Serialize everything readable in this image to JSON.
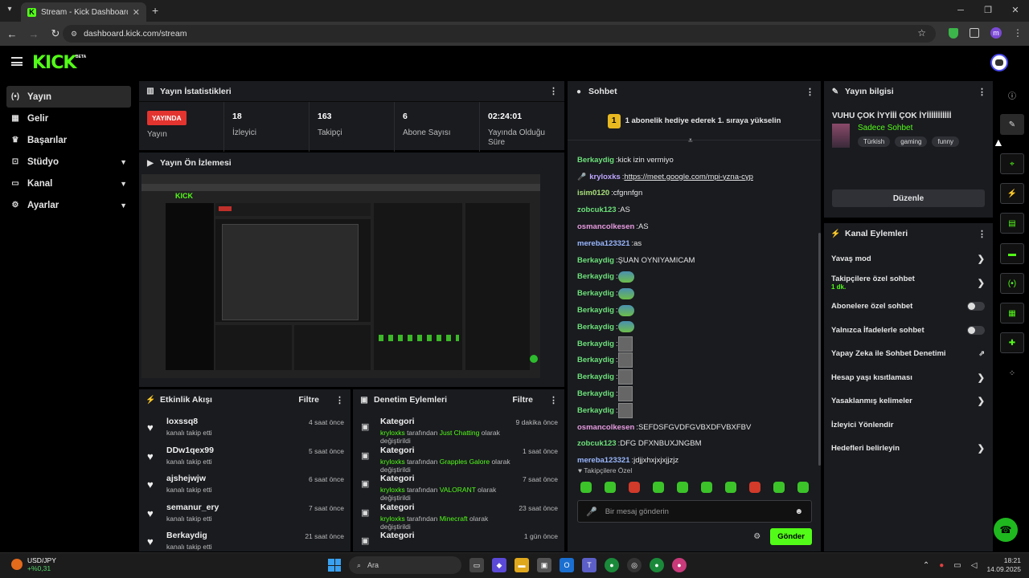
{
  "browser": {
    "tab_title": "Stream - Kick Dashboard",
    "url": "dashboard.kick.com/stream",
    "profile_initial": "m",
    "new_tab_symbol": "+"
  },
  "header": {
    "logo": "KICK",
    "beta": "BETA"
  },
  "sidebar": {
    "items": [
      {
        "label": "Yayın",
        "icon": "broadcast-icon",
        "active": true
      },
      {
        "label": "Gelir",
        "icon": "revenue-icon"
      },
      {
        "label": "Başarılar",
        "icon": "trophy-icon"
      },
      {
        "label": "Stüdyo",
        "icon": "studio-icon",
        "expandable": true
      },
      {
        "label": "Kanal",
        "icon": "channel-icon",
        "expandable": true
      },
      {
        "label": "Ayarlar",
        "icon": "gear-icon",
        "expandable": true
      }
    ]
  },
  "stats": {
    "title": "Yayın İstatistikleri",
    "live_badge": "YAYINDA",
    "live_label": "Yayın",
    "items": [
      {
        "value": "18",
        "label": "İzleyici"
      },
      {
        "value": "163",
        "label": "Takipçi"
      },
      {
        "value": "6",
        "label": "Abone Sayısı"
      },
      {
        "value": "02:24:01",
        "label": "Yayında Olduğu Süre"
      }
    ]
  },
  "preview": {
    "title": "Yayın Ön İzlemesi"
  },
  "activity": {
    "title": "Etkinlik Akışı",
    "filter": "Filtre",
    "rows": [
      {
        "name": "loxssq8",
        "sub": "kanalı takip etti",
        "time": "4 saat önce"
      },
      {
        "name": "DDw1qex99",
        "sub": "kanalı takip etti",
        "time": "5 saat önce"
      },
      {
        "name": "ajshejwjw",
        "sub": "kanalı takip etti",
        "time": "6 saat önce"
      },
      {
        "name": "semanur_ery",
        "sub": "kanalı takip etti",
        "time": "7 saat önce"
      },
      {
        "name": "Berkaydig",
        "sub": "kanalı takip etti",
        "time": "21 saat önce"
      }
    ]
  },
  "moderation": {
    "title": "Denetim Eylemleri",
    "filter": "Filtre",
    "rows": [
      {
        "name": "Kategori",
        "user": "kryloxks",
        "mid": " tarafından ",
        "cat": "Just Chatting",
        "end": " olarak değiştirildi",
        "time": "9 dakika önce"
      },
      {
        "name": "Kategori",
        "user": "kryloxks",
        "mid": " tarafından ",
        "cat": "Grapples Galore",
        "end": " olarak değiştirildi",
        "time": "1 saat önce"
      },
      {
        "name": "Kategori",
        "user": "kryloxks",
        "mid": " tarafından ",
        "cat": "VALORANT",
        "end": " olarak değiştirildi",
        "time": "7 saat önce"
      },
      {
        "name": "Kategori",
        "user": "kryloxks",
        "mid": " tarafından ",
        "cat": "Minecraft",
        "end": " olarak değiştirildi",
        "time": "23 saat önce"
      },
      {
        "name": "Kategori",
        "user": "",
        "mid": "",
        "cat": "",
        "end": "",
        "time": "1 gün önce"
      }
    ]
  },
  "chat": {
    "title": "Sohbet",
    "banner": "1 abonelik hediye ederek 1. sıraya yükselin",
    "messages": [
      {
        "user": "Berkaydig",
        "color": "c-green",
        "text": "kick izin vermiyo"
      },
      {
        "user": "kryloxks",
        "color": "c-lav",
        "text": "https://meet.google.com/mpi-yzna-cyp",
        "link": true,
        "badge": true
      },
      {
        "user": "isim0120",
        "color": "c-lgreen",
        "text": "cfgnnfgn"
      },
      {
        "user": "zobcuk123",
        "color": "c-green",
        "text": "AS"
      },
      {
        "user": "osmancolkesen",
        "color": "c-pink",
        "text": "AS"
      },
      {
        "user": "mereba123321",
        "color": "c-blue",
        "text": "as"
      },
      {
        "user": "Berkaydig",
        "color": "c-green",
        "text": "ŞUAN OYNIYAMICAM"
      },
      {
        "user": "Berkaydig",
        "color": "c-green",
        "emote": "pepe"
      },
      {
        "user": "Berkaydig",
        "color": "c-green",
        "emote": "pepe"
      },
      {
        "user": "Berkaydig",
        "color": "c-green",
        "emote": "pepe"
      },
      {
        "user": "Berkaydig",
        "color": "c-green",
        "emote": "pepe"
      },
      {
        "user": "Berkaydig",
        "color": "c-green",
        "emote": "img"
      },
      {
        "user": "Berkaydig",
        "color": "c-green",
        "emote": "img"
      },
      {
        "user": "Berkaydig",
        "color": "c-green",
        "emote": "img"
      },
      {
        "user": "Berkaydig",
        "color": "c-green",
        "emote": "img"
      },
      {
        "user": "Berkaydig",
        "color": "c-green",
        "emote": "img"
      },
      {
        "user": "osmancolkesen",
        "color": "c-pink",
        "text": "SEFDSFGVDFGVBXDFVBXFBV"
      },
      {
        "user": "zobcuk123",
        "color": "c-green",
        "text": "DFG DFXNBUXJNGBM"
      },
      {
        "user": "mereba123321",
        "color": "c-blue",
        "text": "jdjjxhxjxjxjjzjz"
      }
    ],
    "followers_only": "Takipçilere Özel",
    "input_placeholder": "Bir mesaj gönderin",
    "send": "Gönder"
  },
  "stream_info": {
    "title": "Yayın bilgisi",
    "stream_title": "VUHU ÇOK İYYİİİ ÇOK İYİİİİİİİİİİİ",
    "category": "Sadece Sohbet",
    "tags": [
      "Türkish",
      "gaming",
      "funny"
    ],
    "edit": "Düzenle"
  },
  "channel_actions": {
    "title": "Kanal Eylemleri",
    "rows": [
      {
        "label": "Yavaş mod",
        "type": "arrow"
      },
      {
        "label": "Takipçilere özel sohbet",
        "sub": "1 dk.",
        "type": "arrow"
      },
      {
        "label": "Abonelere özel sohbet",
        "type": "toggle"
      },
      {
        "label": "Yalnızca İfadelerle sohbet",
        "type": "toggle"
      },
      {
        "label": "Yapay Zeka ile Sohbet Denetimi",
        "type": "external"
      },
      {
        "label": "Hesap yaşı kısıtlaması",
        "type": "arrow"
      },
      {
        "label": "Yasaklanmış kelimeler",
        "type": "arrow"
      },
      {
        "label": "İzleyici Yönlendir",
        "type": "none"
      },
      {
        "label": "Hedefleri belirleyin",
        "type": "arrow"
      }
    ]
  },
  "taskbar": {
    "ticker": "USD/JPY",
    "change": "+%0,31",
    "search": "Ara",
    "time": "18:21",
    "date": "14.09.2025"
  },
  "colors": {
    "accent": "#53fc18",
    "live": "#e3342f",
    "panel": "#191b1f"
  }
}
